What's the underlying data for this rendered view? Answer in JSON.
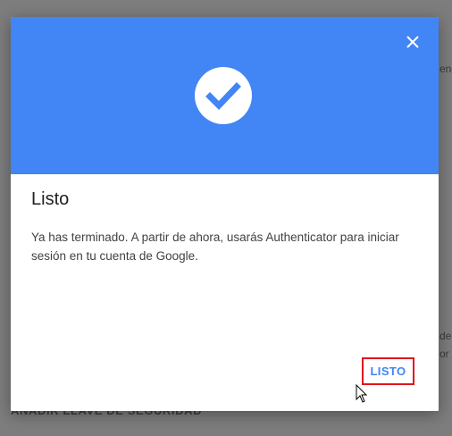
{
  "background": {
    "fragment_top": "enç",
    "fragment_mid_1": "de",
    "fragment_mid_2": "or",
    "bottom_action": "AÑADIR LLAVE DE SEGURIDAD"
  },
  "dialog": {
    "icon": "check-circle-icon",
    "close_icon": "close-icon",
    "title": "Listo",
    "body": "Ya has terminado. A partir de ahora, usarás Authenticator para iniciar sesión en tu cuenta de Google.",
    "done_label": "LISTO",
    "header_color": "#4285f4",
    "highlight_color": "#e0141e"
  }
}
